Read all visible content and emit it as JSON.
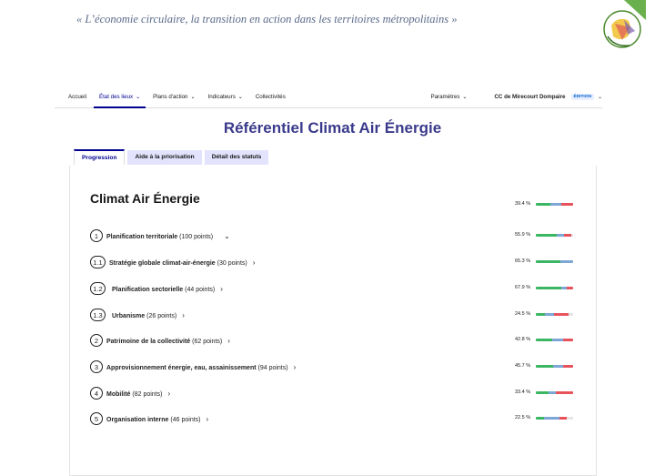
{
  "quote": "« L’économie circulaire, la transition en action dans les territoires métropolitains »",
  "logo": {
    "text": "LES MERCREDIS DE LA GÉOGRAPHIE"
  },
  "nav": {
    "accueil": "Accueil",
    "etat": "État des lieux",
    "plans": "Plans d'action",
    "indicateurs": "Indicateurs",
    "collectivites": "Collectivités",
    "parametres": "Paramètres",
    "org": "CC de Mirecourt Dompaire",
    "badge": "ÉDITION"
  },
  "page_title": "Référentiel Climat Air Énergie",
  "tabs": [
    "Progression",
    "Aide à la priorisation",
    "Détail des statuts"
  ],
  "card": {
    "title": "Climat Air Énergie",
    "total_pct": "39.4 %",
    "rows": [
      {
        "num": "1",
        "label": "Planification territoriale",
        "points": "(100 points)",
        "pct": "55.9 %"
      },
      {
        "num": "1.1",
        "label": "Stratégie globale climat-air-énergie",
        "points": "(30 points)",
        "pct": "65.3 %"
      },
      {
        "num": "1.2",
        "label": "Planification sectorielle",
        "points": "(44 points)",
        "pct": "67.9 %"
      },
      {
        "num": "1.3",
        "label": "Urbanisme",
        "points": "(26 points)",
        "pct": "24.5 %"
      },
      {
        "num": "2",
        "label": "Patrimoine de la collectivité",
        "points": "(62 points)",
        "pct": "42.8 %"
      },
      {
        "num": "3",
        "label": "Approvisionnement énergie, eau, assainissement",
        "points": "(94 points)",
        "pct": "45.7 %"
      },
      {
        "num": "4",
        "label": "Mobilité",
        "points": "(82 points)",
        "pct": "33.4 %"
      },
      {
        "num": "5",
        "label": "Organisation interne",
        "points": "(46 points)",
        "pct": "22.5 %"
      }
    ]
  },
  "colors": {
    "done": "#3bb763",
    "programmed": "#7ea6d6",
    "not_done": "#e8525b",
    "primary": "#000091"
  }
}
